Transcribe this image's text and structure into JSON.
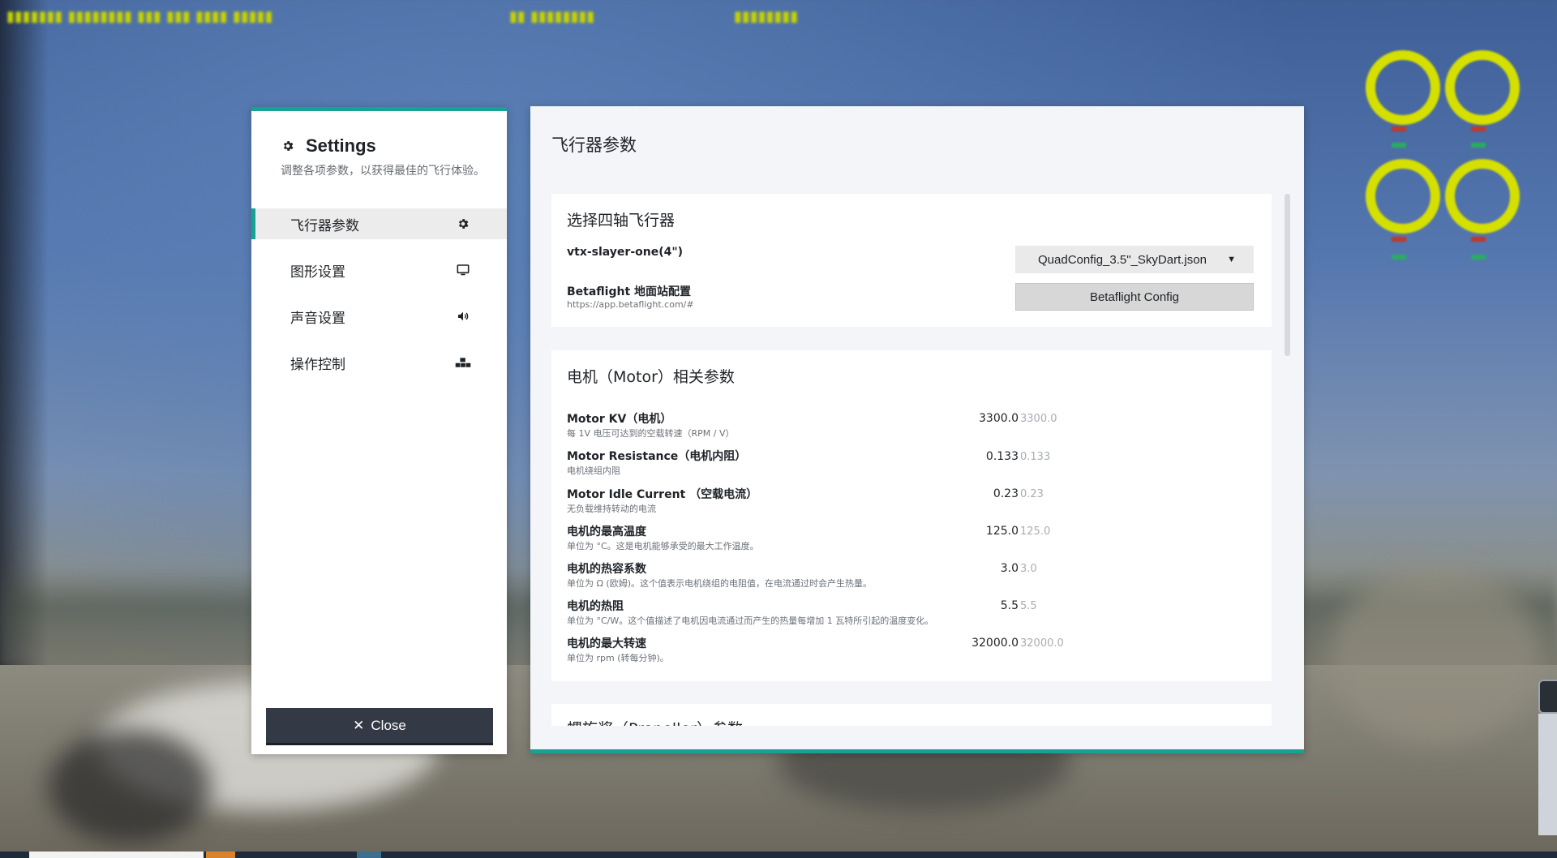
{
  "colors": {
    "accent": "#16a394",
    "dark_button": "#343a45",
    "panel_bg": "#f4f5f9"
  },
  "sidebar": {
    "title": "Settings",
    "title_icon": "gear-icon",
    "subtitle": "调整各项参数，以获得最佳的飞行体验。",
    "items": [
      {
        "label": "飞行器参数",
        "icon": "gear-icon",
        "active": true
      },
      {
        "label": "图形设置",
        "icon": "monitor-icon",
        "active": false
      },
      {
        "label": "声音设置",
        "icon": "speaker-icon",
        "active": false
      },
      {
        "label": "操作控制",
        "icon": "gamepad-icon",
        "active": false
      }
    ],
    "close_label": "Close"
  },
  "main": {
    "title": "飞行器参数",
    "quad_section": {
      "title": "选择四轴飞行器",
      "quad_name": "vtx-slayer-one(4\")",
      "config_select_value": "QuadConfig_3.5\"_SkyDart.json",
      "betaflight_label": "Betaflight 地面站配置",
      "betaflight_url": "https://app.betaflight.com/#",
      "betaflight_button": "Betaflight Config"
    },
    "motor_section": {
      "title": "电机（Motor）相关参数",
      "rows": [
        {
          "label": "Motor KV（电机）",
          "desc": "每 1V 电压可达到的空载转速（RPM / V）",
          "value": "3300.0",
          "default": "3300.0"
        },
        {
          "label": "Motor Resistance（电机内阻）",
          "desc": "电机绕组内阻",
          "value": "0.133",
          "default": "0.133"
        },
        {
          "label": "Motor Idle Current （空载电流）",
          "desc": "无负载维持转动的电流",
          "value": "0.23",
          "default": "0.23"
        },
        {
          "label": "电机的最高温度",
          "desc": "单位为 °C。这是电机能够承受的最大工作温度。",
          "value": "125.0",
          "default": "125.0"
        },
        {
          "label": "电机的热容系数",
          "desc": "单位为 Ω (欧姆)。这个值表示电机绕组的电阻值，在电流通过时会产生热量。",
          "value": "3.0",
          "default": "3.0"
        },
        {
          "label": "电机的热阻",
          "desc": "单位为 °C/W。这个值描述了电机因电流通过而产生的热量每增加 1 瓦特所引起的温度变化。",
          "value": "5.5",
          "default": "5.5"
        },
        {
          "label": "电机的最大转速",
          "desc": "单位为 rpm (转每分钟)。",
          "value": "32000.0",
          "default": "32000.0"
        }
      ]
    },
    "propeller_section": {
      "title": "螺旋桨（Propeller）参数"
    }
  }
}
